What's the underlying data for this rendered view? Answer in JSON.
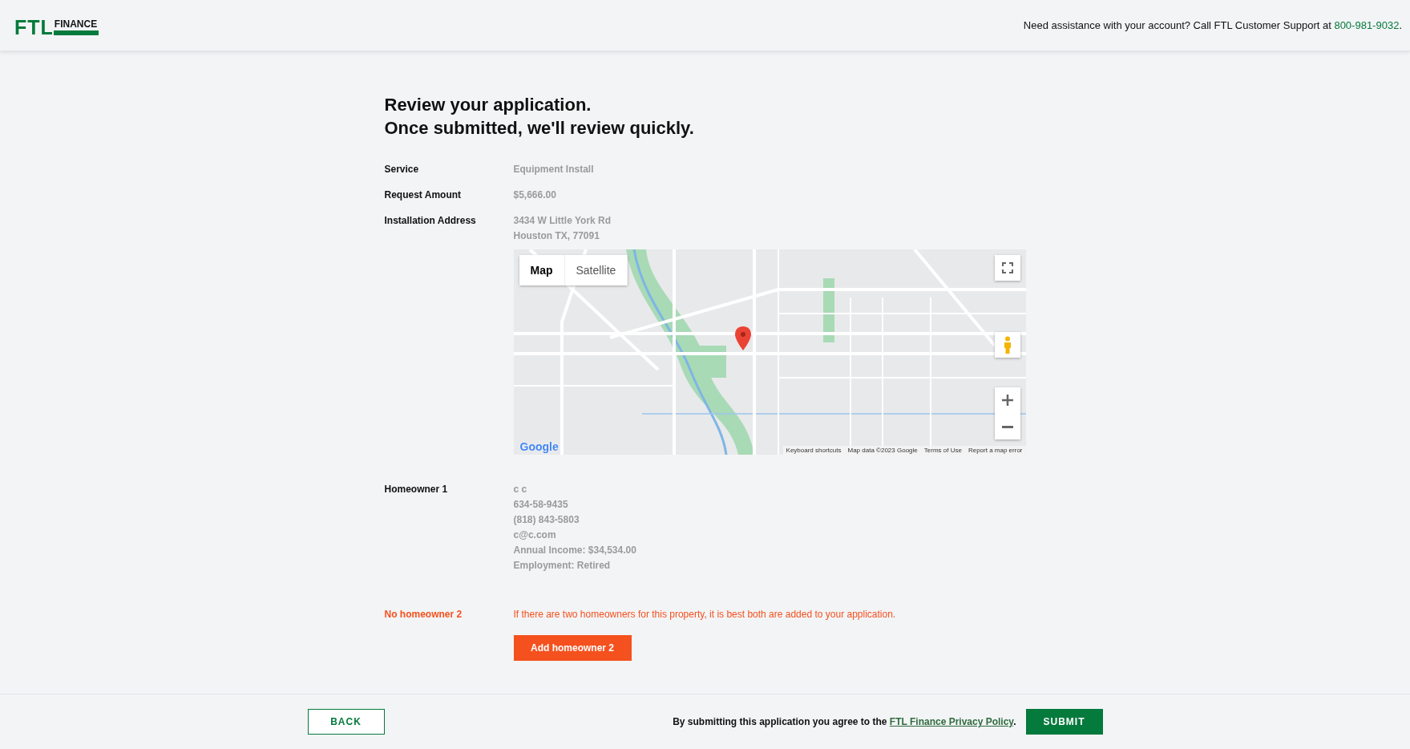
{
  "header": {
    "logo": {
      "mark": "FTL",
      "word": "FINANCE"
    },
    "support": {
      "before": "Need assistance with your account? Call FTL Customer Support at",
      "phone": "800-981-9032",
      "after": "."
    }
  },
  "title_lines": [
    "Review your application.",
    "Once submitted, we'll review quickly."
  ],
  "fields": [
    {
      "label": "Service",
      "values": [
        "Equipment Install"
      ]
    },
    {
      "label": "Request Amount",
      "values": [
        "$5,666.00"
      ]
    },
    {
      "label": "Installation Address",
      "values": [
        "3434 W Little York Rd",
        "Houston TX, 77091"
      ],
      "map": {
        "types": [
          {
            "label": "Map",
            "selected": true
          },
          {
            "label": "Satellite",
            "selected": false
          }
        ],
        "logo": "Google",
        "attribution": [
          "Keyboard shortcuts",
          "Map data ©2023 Google",
          "Terms of Use",
          "Report a map error"
        ]
      }
    },
    {
      "label": "Homeowner 1",
      "values": [
        "c c",
        "634-58-9435",
        "(818) 843-5803",
        "c@c.com",
        "Annual Income: $34,534.00",
        "Employment: Retired"
      ]
    }
  ],
  "missing": {
    "label": "No homeowner 2",
    "message": "If there are two homeowners for this property, it is best both are added to your application.",
    "button": "Add homeowner 2"
  },
  "footer": {
    "back": "BACK",
    "agreement": {
      "before": "By submitting this application you agree to the",
      "link": "FTL Finance Privacy Policy",
      "after": "."
    },
    "submit": "SUBMIT"
  }
}
